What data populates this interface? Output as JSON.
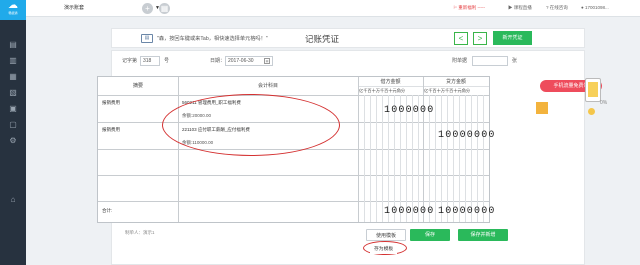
{
  "app": {
    "logo_text": "畅捷通"
  },
  "sidebar": {
    "items": [
      {
        "icon": "document-icon"
      },
      {
        "icon": "ledger-icon"
      },
      {
        "icon": "chart-icon"
      },
      {
        "icon": "book-icon"
      },
      {
        "icon": "calendar-icon"
      },
      {
        "icon": "invoice-icon"
      },
      {
        "icon": "settings-icon"
      },
      {
        "icon": "gift-icon"
      }
    ]
  },
  "topbar": {
    "account": "演示账套",
    "alert_link": "重新福利 -----",
    "course_link": "课程直播",
    "online_link": "在线咨询",
    "phone": "17001098..."
  },
  "voucher_header": {
    "tip": "\"森，按回车键或来Tab，相快速选择单元格吗！\"",
    "title": "记账凭证",
    "prev_label": "<",
    "next_label": ">",
    "new_button": "新开凭证"
  },
  "form": {
    "word_label": "记字第",
    "word_value": "318",
    "number_suffix": "号",
    "date_label": "日期：",
    "date_value": "2017-06-30",
    "attach_label": "附单据",
    "attach_suffix": "张"
  },
  "table": {
    "col_summary": "摘要",
    "col_account": "会计科目",
    "col_debit": "借方金额",
    "col_credit": "贷方金额",
    "digit_units": "亿千百十万千百十元角分",
    "rows": [
      {
        "summary": "报销费用",
        "account": "560211 管理费用_职工福利费",
        "balance": "余额:20000.00",
        "debit": "1000000",
        "credit": ""
      },
      {
        "summary": "报销费用",
        "account": "221103 应付职工薪酬_应付福利费",
        "balance": "余额:110000.00",
        "debit": "",
        "credit": "10000000"
      }
    ],
    "total_label": "合计:",
    "total_debit": "1000000",
    "total_credit": "10000000"
  },
  "footer": {
    "maker": "制单人：演示1",
    "use_template": "使用模板",
    "save": "保存",
    "save_new": "保存并新增",
    "save_as_template": "存为模板"
  },
  "ad": {
    "banner": "手机流量免费领",
    "pct": "0%"
  }
}
